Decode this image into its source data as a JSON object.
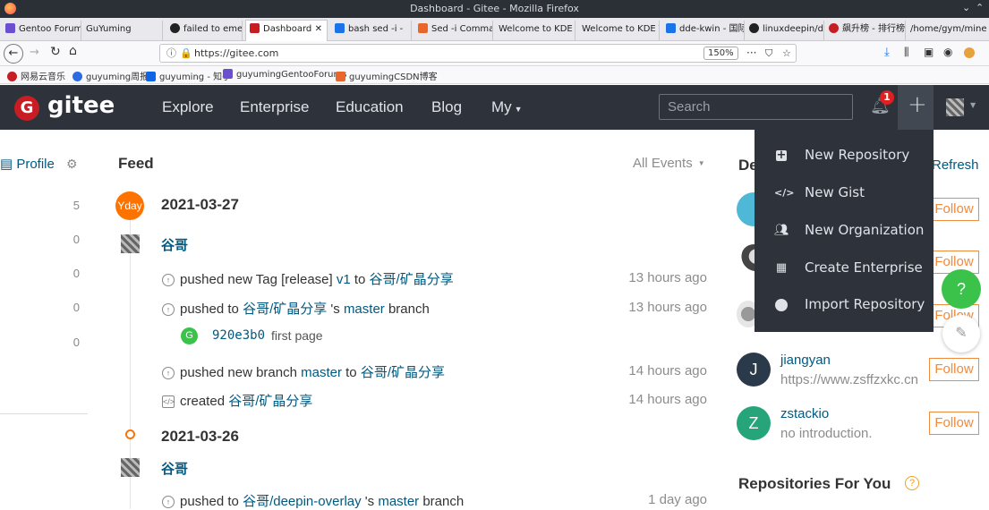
{
  "window": {
    "title": "Dashboard - Gitee - Mozilla Firefox"
  },
  "tabs": [
    {
      "label": "Gentoo Forum",
      "color": "#6c4fd1"
    },
    {
      "label": "GuYuming",
      "color": ""
    },
    {
      "label": "failed to emer",
      "color": "#222"
    },
    {
      "label": "Dashboard",
      "color": "#c71d23"
    },
    {
      "label": "bash sed -i - ",
      "color": "#1a73e8"
    },
    {
      "label": "Sed -i Comma",
      "color": "#e8662b"
    },
    {
      "label": "Welcome to KDE T",
      "color": ""
    },
    {
      "label": "Welcome to KDE T",
      "color": ""
    },
    {
      "label": "dde-kwin - 国际",
      "color": "#1a73e8"
    },
    {
      "label": "linuxdeepin/dd",
      "color": "#222"
    },
    {
      "label": "飙升榜 - 排行榜",
      "color": "#c71d23"
    },
    {
      "label": "/home/gym/mine",
      "color": ""
    }
  ],
  "nav": {
    "url": "https://gitee.com",
    "zoom": "150%",
    "more": "···"
  },
  "bookmarks": [
    {
      "label": "网易云音乐",
      "color": "#c71d23"
    },
    {
      "label": "guyuming周报",
      "color": "#2d6be3"
    },
    {
      "label": "guyuming - 知乎",
      "color": "#0e66e7"
    },
    {
      "label": "guyumingGentooForums",
      "color": "#6c4fd1"
    },
    {
      "label": "guyumingCSDN博客",
      "color": "#e8662b"
    }
  ],
  "header": {
    "logo": "gitee",
    "nav": [
      "Explore",
      "Enterprise",
      "Education",
      "Blog",
      "My"
    ],
    "search_placeholder": "Search",
    "notifications": "1",
    "plus": "+"
  },
  "sidebar": {
    "profile_label": "Profile",
    "counts": [
      "5",
      "0",
      "0",
      "0",
      "0"
    ]
  },
  "feed": {
    "title": "Feed",
    "filter": "All Events",
    "groups": [
      {
        "badge": "Yday",
        "date": "2021-03-27",
        "user": "谷哥",
        "events": [
          {
            "pre": "pushed new Tag [release] ",
            "link1": "v1",
            "mid": " to ",
            "link2": "谷哥/矿晶分享",
            "post": "",
            "time": "13 hours ago"
          },
          {
            "pre": "pushed to ",
            "link1": "谷哥/矿晶分享",
            "mid": " 's ",
            "link2": "master",
            "post": " branch",
            "time": "13 hours ago"
          },
          {
            "pre": "pushed new branch ",
            "link1": "master",
            "mid": " to ",
            "link2": "谷哥/矿晶分享",
            "post": "",
            "time": "14 hours ago"
          },
          {
            "pre": "created ",
            "link1": "谷哥/矿晶分享",
            "mid": "",
            "link2": "",
            "post": "",
            "time": "14 hours ago"
          }
        ],
        "commit": {
          "avatar": "G",
          "sha": "920e3b0",
          "message": "first page"
        }
      },
      {
        "badge": "",
        "date": "2021-03-26",
        "user": "谷哥",
        "events": [
          {
            "pre": "pushed to ",
            "link1": "谷哥/deepin-overlay",
            "mid": " 's ",
            "link2": "master",
            "post": " branch",
            "time": "1 day ago"
          }
        ]
      }
    ]
  },
  "right": {
    "title_fragment": "De",
    "refresh": "Refresh",
    "follow_label": "Follow",
    "people": [
      {
        "name": "jiangyan",
        "desc": "https://www.zsffzxkc.cn",
        "initial": "J",
        "color": "#2b3a4a"
      },
      {
        "name": "zstackio",
        "desc": "no introduction.",
        "initial": "Z",
        "color": "#27a57a"
      }
    ],
    "repos_title": "Repositories For You",
    "help": "?"
  },
  "dropdown": {
    "items": [
      {
        "label": "New Repository",
        "icon": "plus-square-icon"
      },
      {
        "label": "New Gist",
        "icon": "code-icon"
      },
      {
        "label": "New Organization",
        "icon": "users-icon"
      },
      {
        "label": "Create Enterprise",
        "icon": "building-icon"
      },
      {
        "label": "Import Repository",
        "icon": "github-icon"
      }
    ]
  },
  "colors": {
    "accent": "#c71d23",
    "link": "#005980",
    "orange": "#fe7300",
    "green": "#3ac24b",
    "header": "#2e333b"
  }
}
